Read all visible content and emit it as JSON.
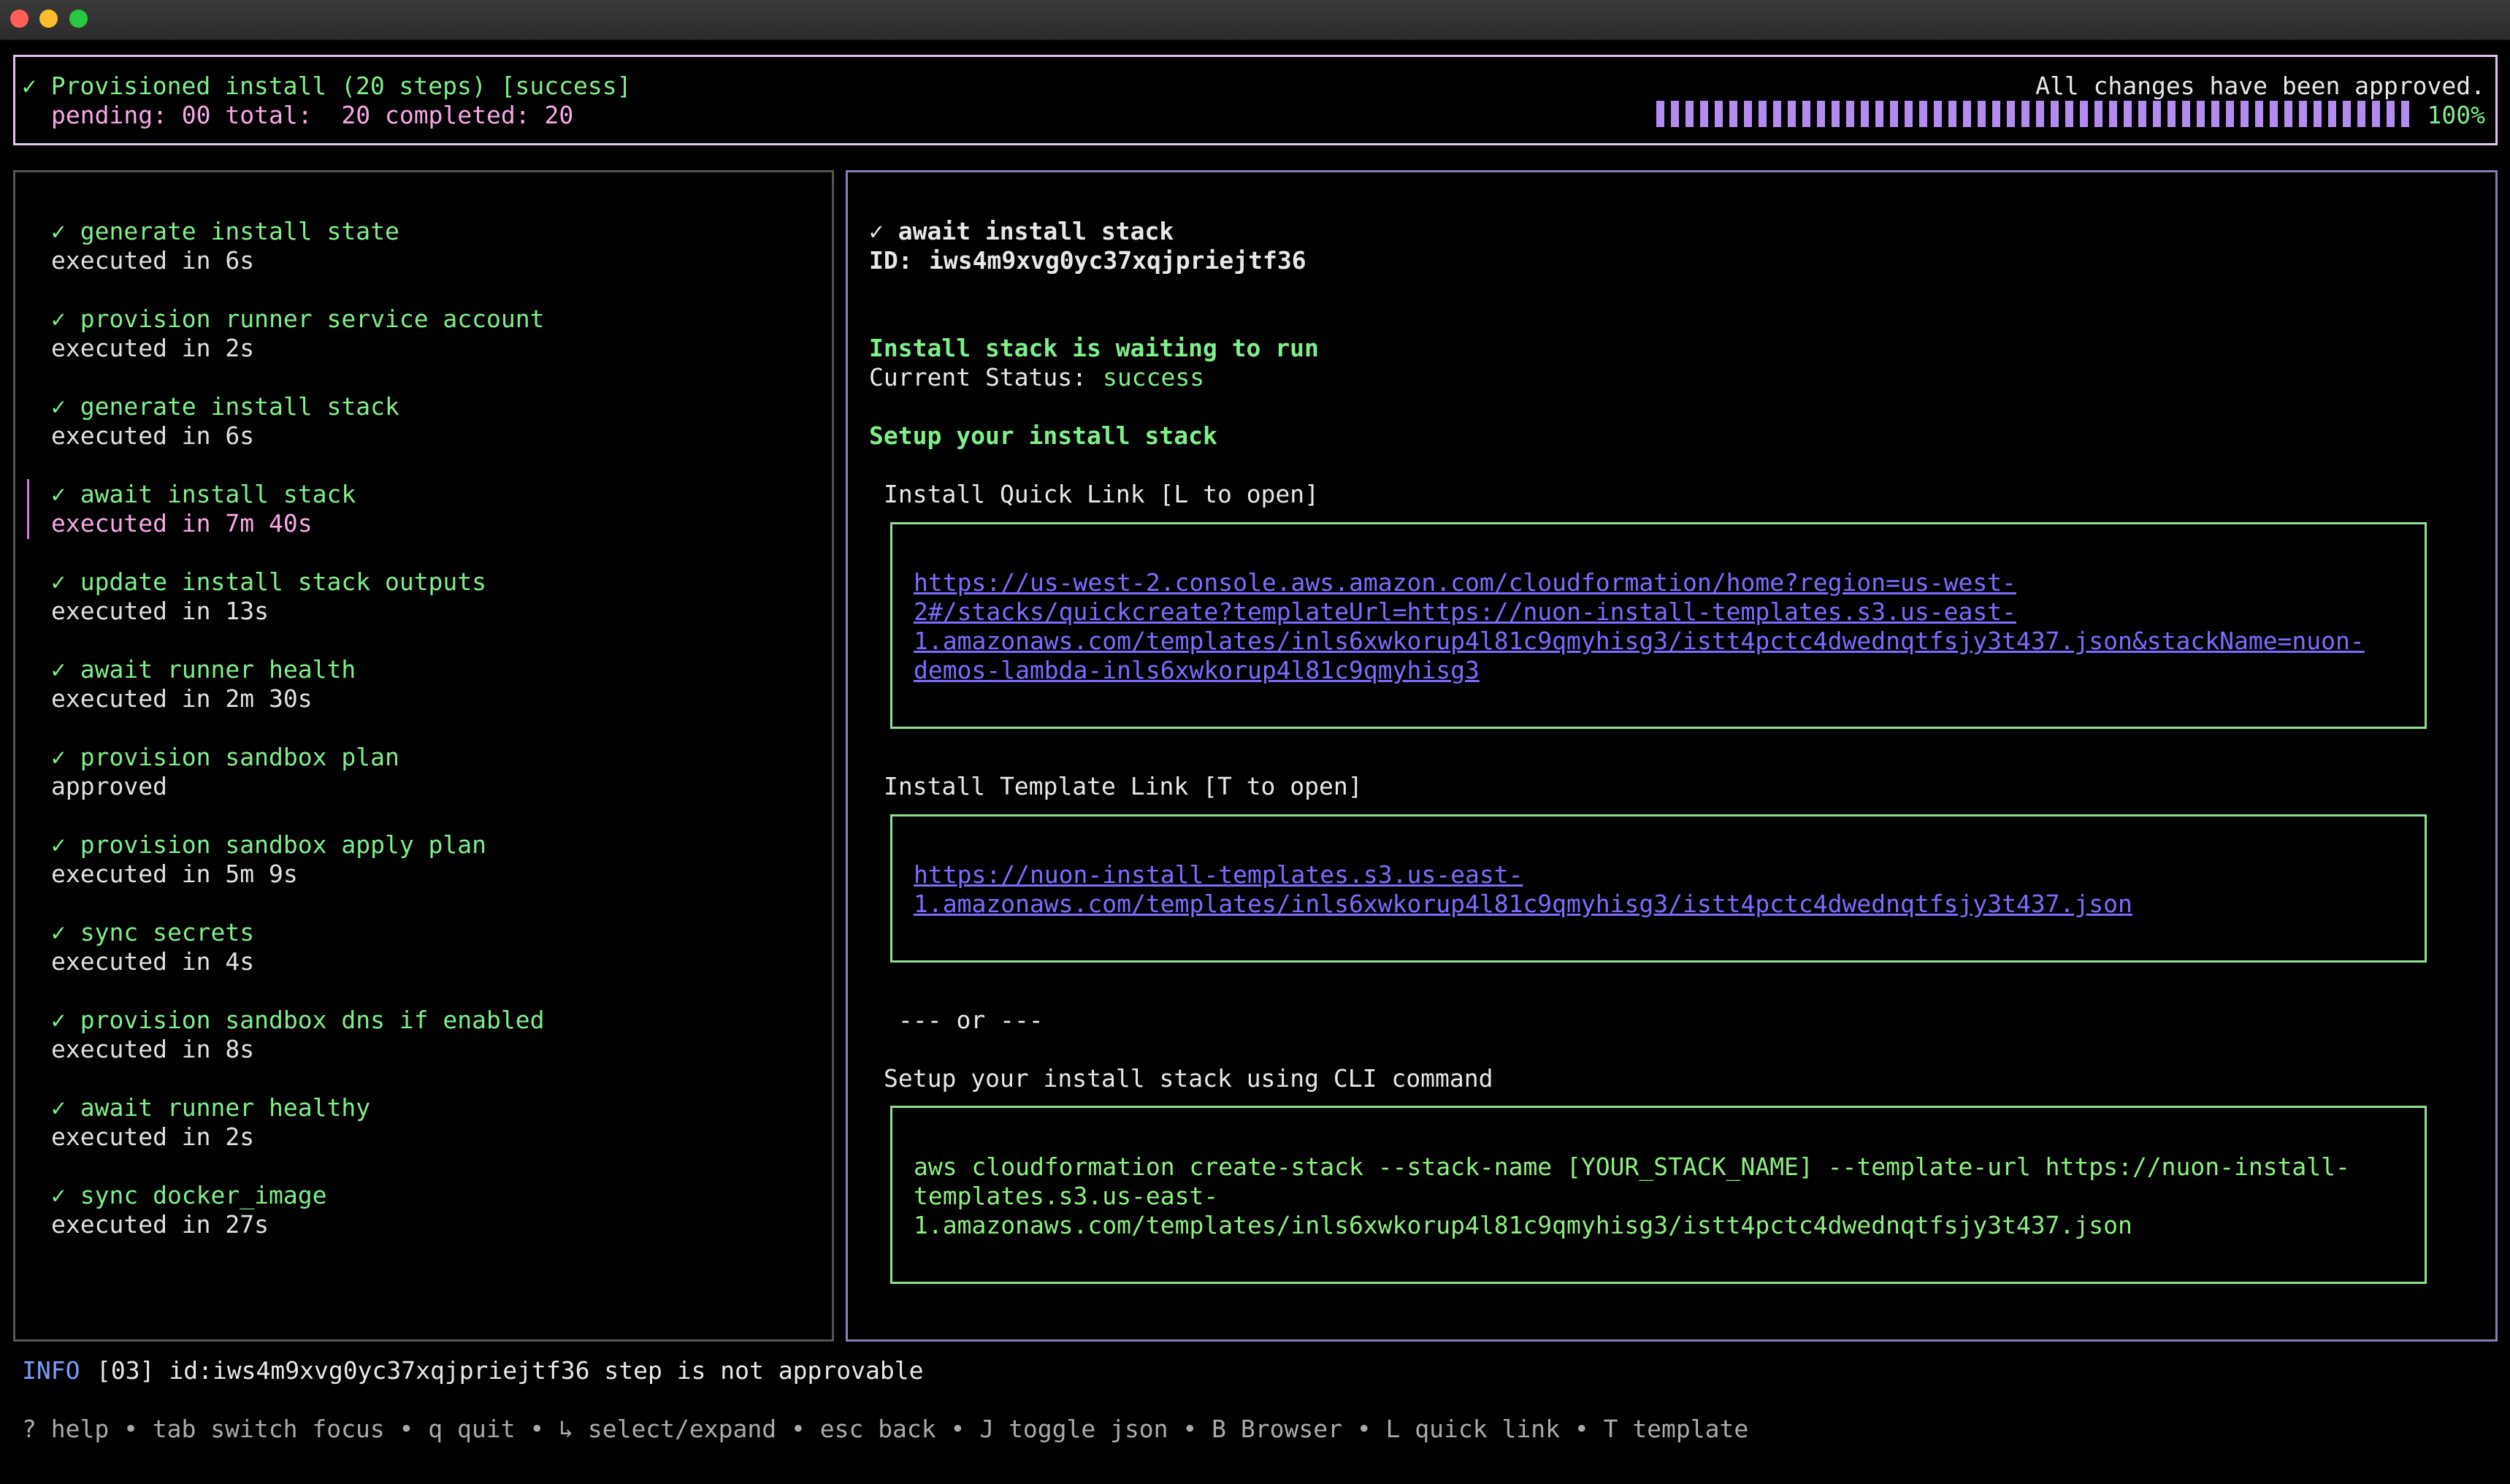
{
  "window": {
    "controls": [
      "close",
      "minimize",
      "zoom"
    ]
  },
  "header": {
    "title": "✓ Provisioned install (20 steps) [success]",
    "counts": "pending: 00 total:  20 completed: 20",
    "approval_message": "All changes have been approved.",
    "progress_label": "100%",
    "progress_fraction": 1.0
  },
  "steps": [
    {
      "name": "✓ generate install state",
      "detail": "executed in 6s"
    },
    {
      "name": "✓ provision runner service account",
      "detail": "executed in 2s"
    },
    {
      "name": "✓ generate install stack",
      "detail": "executed in 6s"
    },
    {
      "name": "✓ await install stack",
      "detail": "executed in 7m 40s"
    },
    {
      "name": "✓ update install stack outputs",
      "detail": "executed in 13s"
    },
    {
      "name": "✓ await runner health",
      "detail": "executed in 2m 30s"
    },
    {
      "name": "✓ provision sandbox plan",
      "detail": "approved"
    },
    {
      "name": "✓ provision sandbox apply plan",
      "detail": "executed in 5m 9s"
    },
    {
      "name": "✓ sync secrets",
      "detail": "executed in 4s"
    },
    {
      "name": "✓ provision sandbox dns if enabled",
      "detail": "executed in 8s"
    },
    {
      "name": "✓ await runner healthy",
      "detail": "executed in 2s"
    },
    {
      "name": "✓ sync docker_image",
      "detail": "executed in 27s"
    }
  ],
  "detail": {
    "title": "✓ await install stack",
    "id_label": "ID:",
    "id_value": "iws4m9xvg0yc37xqjpriejtf36",
    "waiting_heading": "Install stack is waiting to run",
    "status_label": "Current Status:",
    "status_value": "success",
    "setup_heading": "Setup your install stack",
    "quick_link_label": "Install Quick Link [L to open]",
    "quick_link_lines": [
      "https://us-west-2.console.aws.amazon.com/cloudformation/home?region=us-west-",
      "2#/stacks/quickcreate?templateUrl=https://nuon-install-templates.s3.us-east-",
      "1.amazonaws.com/templates/inls6xwkorup4l81c9qmyhisg3/istt4pctc4dwednqtfsjy3t437.json&stackName=nuon-",
      "demos-lambda-inls6xwkorup4l81c9qmyhisg3"
    ],
    "template_link_label": "Install Template Link [T to open]",
    "template_link_lines": [
      "https://nuon-install-templates.s3.us-east-",
      "1.amazonaws.com/templates/inls6xwkorup4l81c9qmyhisg3/istt4pctc4dwednqtfsjy3t437.json"
    ],
    "or_separator": "--- or ---",
    "cli_label": "Setup your install stack using CLI command",
    "cli_lines": [
      "aws cloudformation create-stack --stack-name [YOUR_STACK_NAME] --template-url https://nuon-install-",
      "templates.s3.us-east-",
      "1.amazonaws.com/templates/inls6xwkorup4l81c9qmyhisg3/istt4pctc4dwednqtfsjy3t437.json"
    ]
  },
  "status_line": {
    "level": "INFO",
    "message": "[03] id:iws4m9xvg0yc37xqjpriejtf36 step is not approvable"
  },
  "footer": {
    "help_text": "? help • tab switch focus • q quit • ↳ select/expand • esc back • J toggle json • B Browser • L quick link • T template"
  },
  "colors": {
    "accent_green": "#7ef08a",
    "accent_pink": "#f7a8e6",
    "progress_purple": "#b48cf0",
    "link_blue": "#7b6cff",
    "info_blue": "#7b9cff"
  }
}
